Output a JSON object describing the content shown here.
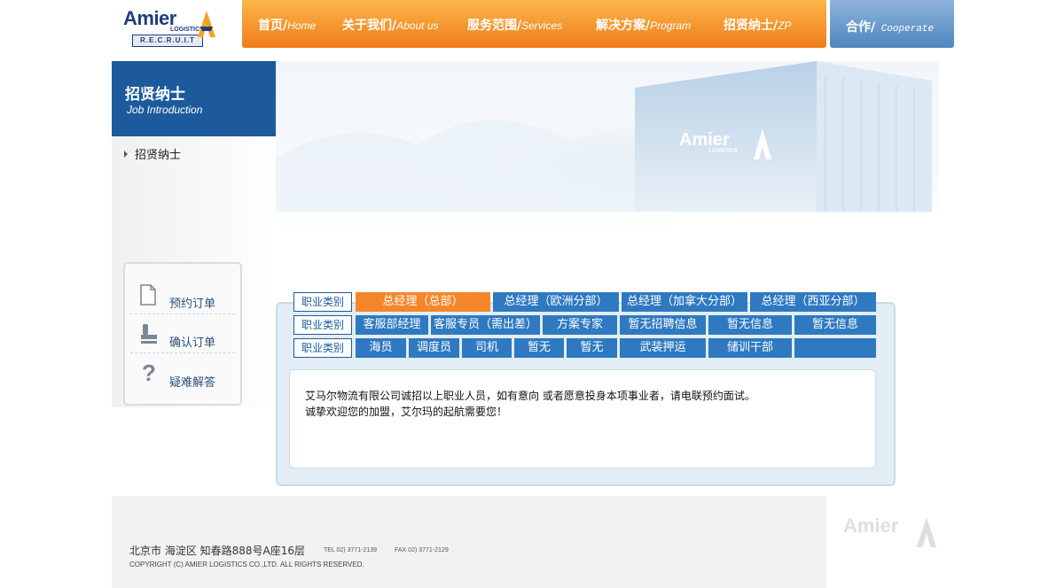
{
  "logo": {
    "brand": "Amier",
    "sub": "LOGISTICS",
    "recruit": "R.E.C.R.U.I.T"
  },
  "nav": [
    {
      "cn": "首页/",
      "en": "Home"
    },
    {
      "cn": "关于我们/",
      "en": "About us"
    },
    {
      "cn": "服务范围/",
      "en": "Services"
    },
    {
      "cn": "解决方案/",
      "en": "Program"
    },
    {
      "cn": "招贤纳士/",
      "en": "ZP"
    }
  ],
  "coop": {
    "cn": "合作/",
    "en": " Cooperate"
  },
  "sidebar": {
    "title_cn": "招贤纳士",
    "title_en": "Job Introduction",
    "link": "招贤纳士",
    "quick_links": [
      "预约订单",
      "确认订单",
      "疑难解答"
    ]
  },
  "banner": {
    "brand": "Amier",
    "sub": "LOGISTICS"
  },
  "jobs": {
    "category_label": "职业类别",
    "rows": [
      [
        "总经理（总部）",
        "总经理（欧洲分部）",
        "总经理（加拿大分部）",
        "总经理（西亚分部）"
      ],
      [
        "客服部经理",
        "客服专员（需出差）",
        "方案专家",
        "暂无招聘信息",
        "暂无信息",
        "暂无信息"
      ],
      [
        "海员",
        "调度员",
        "司机",
        "暂无",
        "暂无",
        "武装押运",
        "储训干部",
        ""
      ]
    ],
    "message": [
      "艾马尔物流有限公司诚招以上职业人员，如有意向 或者愿意投身本项事业者，请电联预约面试。",
      "诚挚欢迎您的加盟，艾尔玛的起航需要您！"
    ]
  },
  "footer": {
    "address": "北京市  海淀区  知春路888号A座16层",
    "tel": "TEL 02) 3771-2139",
    "fax": "FAX 02) 3771-2129",
    "copyright": "COPYRIGHT (C) AMIER LOGISTICS CO.,LTD. ALL RIGHTS RESERVED.",
    "logo": "Amier"
  },
  "colors": {
    "orange": "#f6862a",
    "blue": "#2f79c1",
    "navy": "#1d5a9b",
    "panel": "#e2edf5"
  },
  "icons": [
    "logo-mark-icon",
    "document-icon",
    "stamp-icon",
    "question-icon",
    "arrow-right-icon"
  ]
}
